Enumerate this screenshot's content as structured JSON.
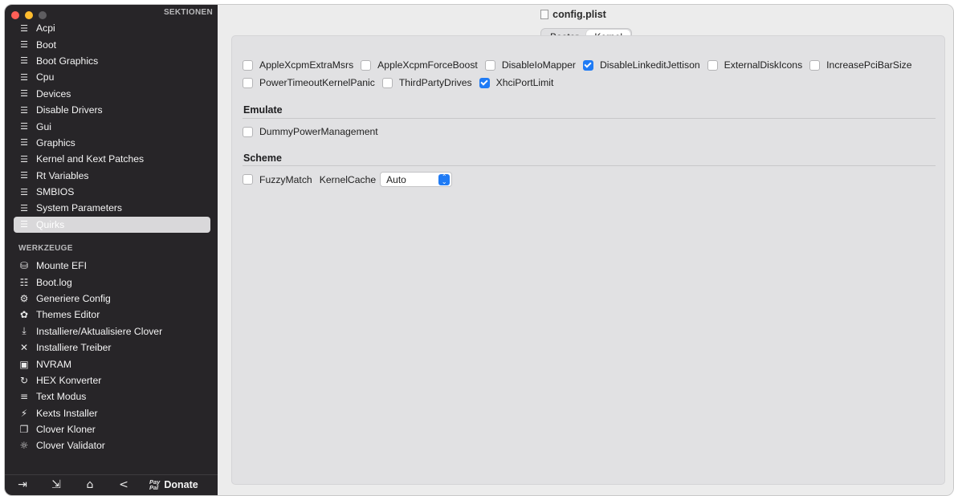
{
  "sidebar": {
    "sections_header": "SEKTIONEN",
    "items": [
      {
        "label": "Acpi",
        "icon": "list-icon"
      },
      {
        "label": "Boot",
        "icon": "list-icon"
      },
      {
        "label": "Boot Graphics",
        "icon": "list-icon"
      },
      {
        "label": "Cpu",
        "icon": "list-icon"
      },
      {
        "label": "Devices",
        "icon": "list-icon"
      },
      {
        "label": "Disable Drivers",
        "icon": "list-icon"
      },
      {
        "label": "Gui",
        "icon": "list-icon"
      },
      {
        "label": "Graphics",
        "icon": "list-icon"
      },
      {
        "label": "Kernel and Kext Patches",
        "icon": "list-icon"
      },
      {
        "label": "Rt Variables",
        "icon": "list-icon"
      },
      {
        "label": "SMBIOS",
        "icon": "list-icon"
      },
      {
        "label": "System Parameters",
        "icon": "list-icon"
      },
      {
        "label": "Quirks",
        "icon": "list-icon",
        "selected": true
      }
    ],
    "tools_header": "WERKZEUGE",
    "tools": [
      {
        "label": "Mounte EFI",
        "icon": "disk-icon"
      },
      {
        "label": "Boot.log",
        "icon": "log-search-icon"
      },
      {
        "label": "Generiere Config",
        "icon": "gears-icon"
      },
      {
        "label": "Themes Editor",
        "icon": "palette-icon"
      },
      {
        "label": "Installiere/Aktualisiere Clover",
        "icon": "download-icon"
      },
      {
        "label": "Installiere Treiber",
        "icon": "tools-icon"
      },
      {
        "label": "NVRAM",
        "icon": "chip-icon"
      },
      {
        "label": "HEX Konverter",
        "icon": "convert-icon"
      },
      {
        "label": "Text Modus",
        "icon": "text-lines-icon"
      },
      {
        "label": "Kexts Installer",
        "icon": "plug-icon"
      },
      {
        "label": "Clover Kloner",
        "icon": "clone-icon"
      },
      {
        "label": "Clover Validator",
        "icon": "lightbulb-icon"
      }
    ],
    "bottom": {
      "paypal_top": "Pay",
      "paypal_bottom": "Pal",
      "donate_label": "Donate"
    }
  },
  "main": {
    "title": "config.plist",
    "tabs": [
      {
        "label": "Booter",
        "active": false
      },
      {
        "label": "Kernel",
        "active": true
      }
    ],
    "kernel_quirks_row1": [
      {
        "label": "AppleXcpmExtraMsrs",
        "checked": false
      },
      {
        "label": "AppleXcpmForceBoost",
        "checked": false
      },
      {
        "label": "DisableIoMapper",
        "checked": false
      },
      {
        "label": "DisableLinkeditJettison",
        "checked": true
      },
      {
        "label": "ExternalDiskIcons",
        "checked": false
      },
      {
        "label": "IncreasePciBarSize",
        "checked": false
      }
    ],
    "kernel_quirks_row2": [
      {
        "label": "PowerTimeoutKernelPanic",
        "checked": false
      },
      {
        "label": "ThirdPartyDrives",
        "checked": false
      },
      {
        "label": "XhciPortLimit",
        "checked": true
      }
    ],
    "emulate": {
      "title": "Emulate",
      "items": [
        {
          "label": "DummyPowerManagement",
          "checked": false
        }
      ]
    },
    "scheme": {
      "title": "Scheme",
      "fuzzy_match": {
        "label": "FuzzyMatch",
        "checked": false
      },
      "kernel_cache_label": "KernelCache",
      "kernel_cache_value": "Auto"
    }
  },
  "colors": {
    "accent": "#1f7bf5",
    "sidebar_bg": "#272528",
    "main_bg": "#ececec"
  }
}
